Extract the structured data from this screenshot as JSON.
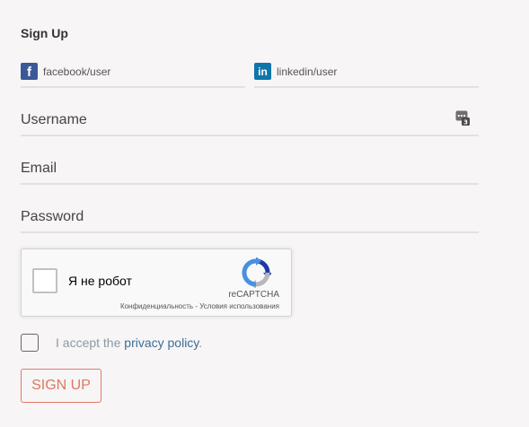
{
  "form": {
    "title": "Sign Up",
    "facebook": {
      "label": "facebook/user",
      "icon": "facebook-icon",
      "color": "#3b5998",
      "glyph": "f"
    },
    "linkedin": {
      "label": "linkedin/user",
      "icon": "linkedin-icon",
      "color": "#0e76a8",
      "glyph": "in"
    },
    "username": {
      "placeholder": "Username",
      "value": ""
    },
    "email": {
      "placeholder": "Email",
      "value": ""
    },
    "password": {
      "placeholder": "Password",
      "value": ""
    },
    "recaptcha": {
      "label": "Я не робот",
      "brand": "reCAPTCHA",
      "privacy": "Конфиденциальность",
      "separator": " - ",
      "terms": "Условия использования"
    },
    "accept": {
      "prefix": "I accept the ",
      "link": "privacy policy",
      "suffix": "."
    },
    "submit_label": "SIGN UP",
    "accent_color": "#e0775f"
  }
}
